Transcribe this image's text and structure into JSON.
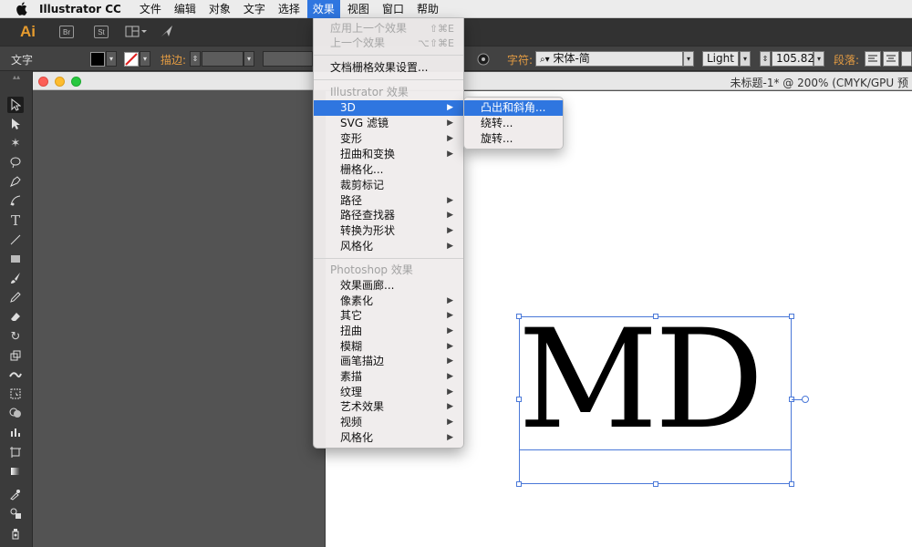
{
  "menubar": {
    "app_name": "Illustrator CC",
    "items": [
      "文件",
      "编辑",
      "对象",
      "文字",
      "选择",
      "效果",
      "视图",
      "窗口",
      "帮助"
    ],
    "active_index": 5
  },
  "appbar": {
    "logo": "Ai",
    "bridge_label": "Br",
    "stock_label": "St"
  },
  "controlbar": {
    "type_label": "文字",
    "stroke_label": "描边:",
    "char_label": "字符:",
    "font_name": "宋体-简",
    "font_style": "Light",
    "font_size": "105.82",
    "para_label": "段落:"
  },
  "document": {
    "title": "未标题-1* @ 200% (CMYK/GPU 预"
  },
  "artwork": {
    "text": "MD"
  },
  "effect_menu": {
    "apply_last": "应用上一个效果",
    "apply_last_shortcut": "⇧⌘E",
    "last_effect": "上一个效果",
    "last_effect_shortcut": "⌥⇧⌘E",
    "raster_settings": "文档栅格效果设置...",
    "illustrator_header": "Illustrator 效果",
    "illustrator_items": [
      "3D",
      "SVG 滤镜",
      "变形",
      "扭曲和变换",
      "栅格化...",
      "裁剪标记",
      "路径",
      "路径查找器",
      "转换为形状",
      "风格化"
    ],
    "photoshop_header": "Photoshop 效果",
    "photoshop_items": [
      "效果画廊...",
      "像素化",
      "其它",
      "扭曲",
      "模糊",
      "画笔描边",
      "素描",
      "纹理",
      "艺术效果",
      "视频",
      "风格化"
    ]
  },
  "submenu_3d": {
    "items": [
      "凸出和斜角...",
      "绕转...",
      "旋转..."
    ]
  },
  "colors": {
    "accent": "#2f76e0",
    "ai_orange": "#e69b2e",
    "selection_blue": "#4a78d8"
  }
}
